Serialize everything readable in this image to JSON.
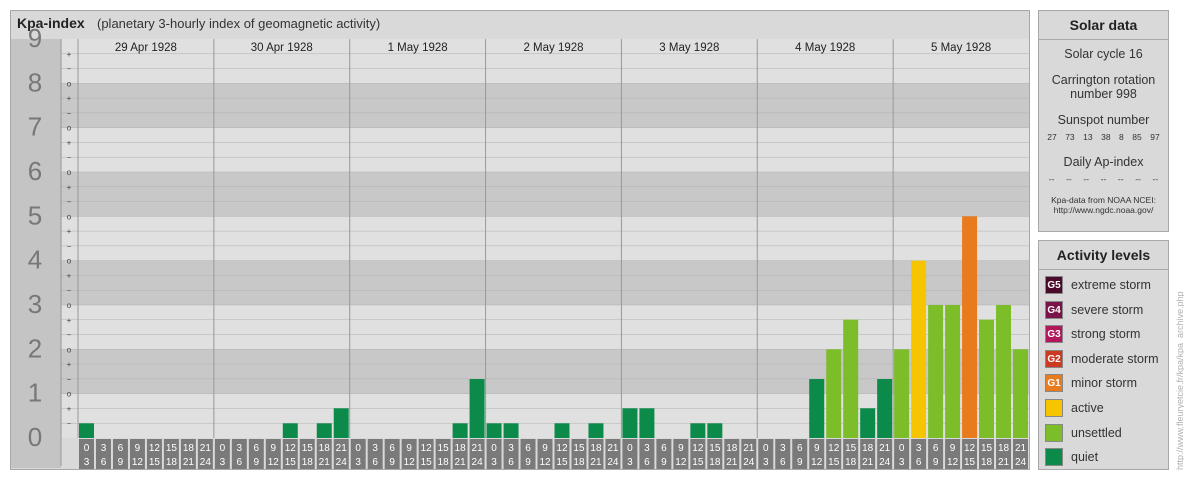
{
  "header": {
    "title": "Kpa-index",
    "subtitle": "(planetary 3-hourly index of geomagnetic activity)"
  },
  "chart_data": {
    "type": "bar",
    "ylim": [
      0,
      9
    ],
    "y_ticks": [
      "0",
      "1",
      "2",
      "3",
      "4",
      "5",
      "6",
      "7",
      "8",
      "9"
    ],
    "minor_tick_labels": [
      "−",
      "+",
      "o"
    ],
    "days": [
      "29 Apr 1928",
      "30 Apr 1928",
      "1 May 1928",
      "2 May 1928",
      "3 May 1928",
      "4 May 1928",
      "5 May 1928"
    ],
    "interval_top": [
      "0",
      "3",
      "6",
      "9",
      "12",
      "15",
      "18",
      "21"
    ],
    "interval_bottom": [
      "3",
      "6",
      "9",
      "12",
      "15",
      "18",
      "21",
      "24"
    ],
    "values": [
      [
        0.33,
        0,
        0,
        0,
        0,
        0,
        0,
        0
      ],
      [
        0,
        0,
        0,
        0,
        0.33,
        0,
        0.33,
        0.67
      ],
      [
        0,
        0,
        0,
        0,
        0,
        0,
        0.33,
        1.33
      ],
      [
        0.33,
        0.33,
        0,
        0,
        0.33,
        0,
        0.33,
        0
      ],
      [
        0.67,
        0.67,
        0,
        0,
        0.33,
        0.33,
        0,
        0
      ],
      [
        0,
        0,
        0,
        1.33,
        2,
        2.67,
        0.67,
        1.33
      ],
      [
        2,
        4,
        3,
        3,
        5,
        2.67,
        3,
        2
      ]
    ],
    "level_colors": {
      "quiet": "#0b8a4a",
      "unsettled": "#7cbd2a",
      "active": "#f7c400",
      "G1": "#e87b1e",
      "G2": "#cc3a22",
      "G3": "#b0185a",
      "G4": "#7a1448",
      "G5": "#4b0a2a"
    }
  },
  "solar": {
    "title": "Solar data",
    "cycle": "Solar cycle 16",
    "carrington_1": "Carrington rotation",
    "carrington_2": "number 998",
    "sunspot_title": "Sunspot number",
    "sunspot_values": [
      "27",
      "73",
      "13",
      "38",
      "8",
      "85",
      "97"
    ],
    "ap_title": "Daily Ap-index",
    "ap_values": [
      "--",
      "--",
      "--",
      "--",
      "--",
      "--",
      "--"
    ],
    "source_1": "Kpa-data from NOAA NCEI:",
    "source_2": "http://www.ngdc.noaa.gov/"
  },
  "activity": {
    "title": "Activity levels",
    "items": [
      {
        "badge": "G5",
        "label": "extreme storm",
        "color": "#4b0a2a"
      },
      {
        "badge": "G4",
        "label": "severe storm",
        "color": "#7a1448"
      },
      {
        "badge": "G3",
        "label": "strong storm",
        "color": "#b0185a"
      },
      {
        "badge": "G2",
        "label": "moderate storm",
        "color": "#cc3a22"
      },
      {
        "badge": "G1",
        "label": "minor storm",
        "color": "#e87b1e"
      },
      {
        "badge": "",
        "label": "active",
        "color": "#f7c400"
      },
      {
        "badge": "",
        "label": "unsettled",
        "color": "#7cbd2a"
      },
      {
        "badge": "",
        "label": "quiet",
        "color": "#0b8a4a"
      }
    ]
  },
  "watermark": "http://www.fleuryetcie.fr/kpa/kpa_archive.php"
}
